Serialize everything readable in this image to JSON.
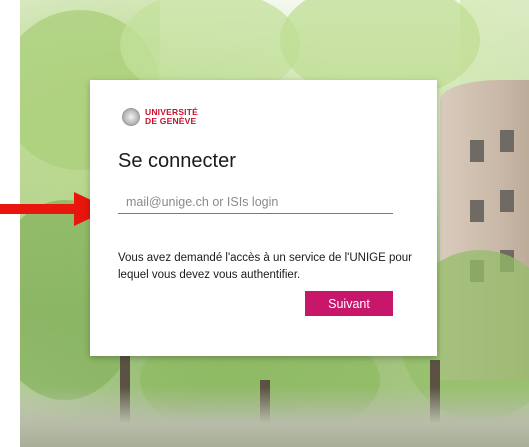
{
  "brand": {
    "line1": "UNIVERSITÉ",
    "line2": "DE GENÈVE",
    "color": "#c8102e"
  },
  "login": {
    "title": "Se connecter",
    "email_placeholder": "mail@unige.ch or ISIs login",
    "email_value": "",
    "notice": "Vous avez demandé l'accès à un service de l'UNIGE pour lequel vous devez vous authentifier.",
    "submit_label": "Suivant",
    "submit_color": "#c8166a"
  },
  "annotation": {
    "arrow_color": "#e8160c"
  }
}
